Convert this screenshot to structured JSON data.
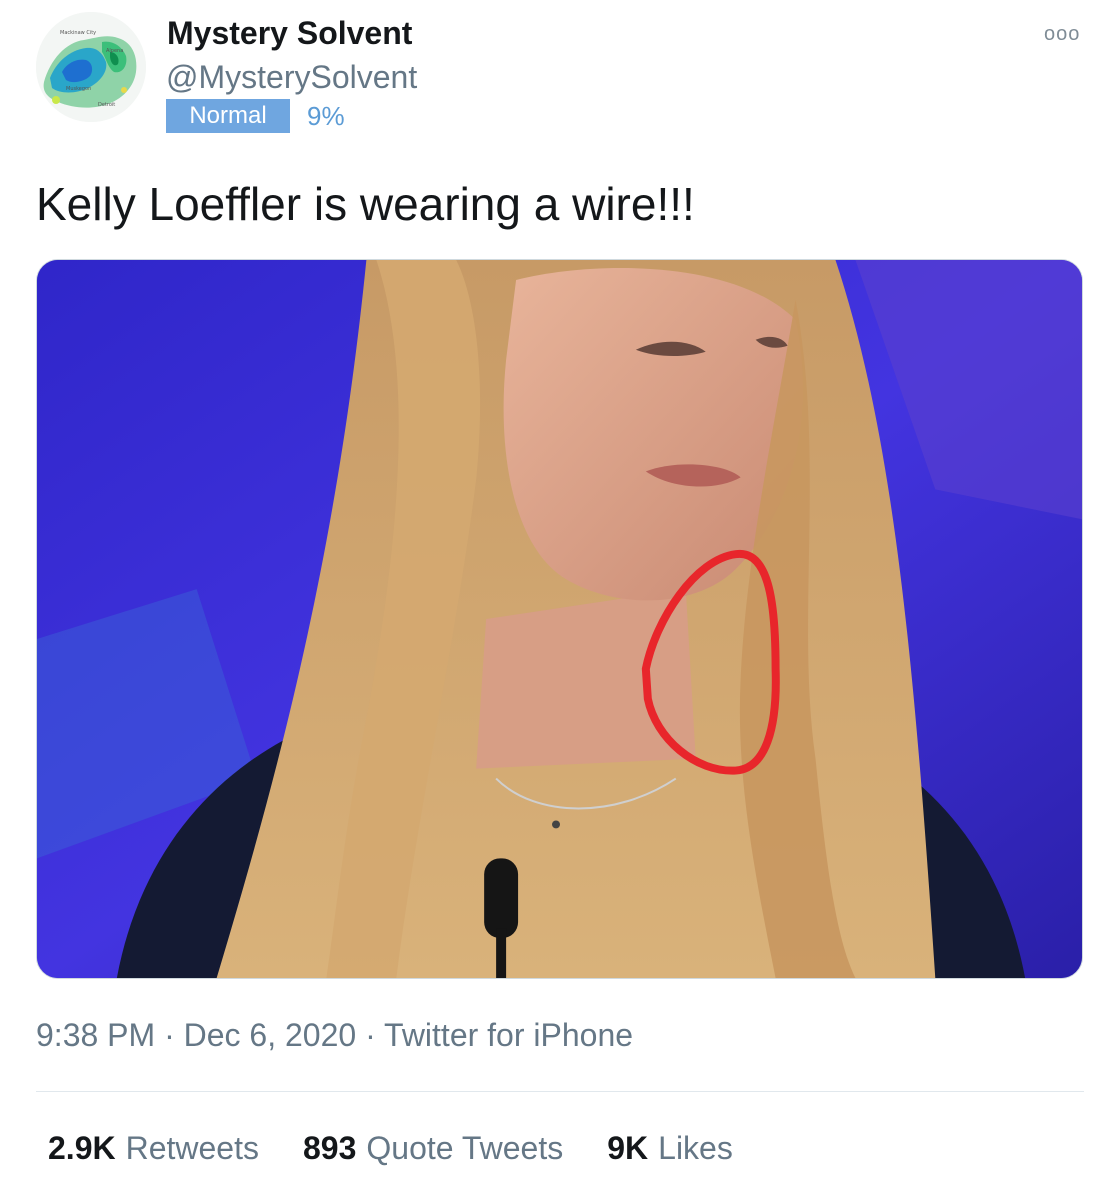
{
  "author": {
    "display_name": "Mystery Solvent",
    "handle": "@MysterySolvent",
    "badge": "Normal",
    "badge_percent": "9%"
  },
  "avatar": {
    "map_labels": [
      "Mackinaw City",
      "Alpena",
      "Muskegon",
      "Detroit"
    ]
  },
  "tweet": {
    "text": "Kelly Loeffler is wearing a wire!!!",
    "time": "9:38 PM",
    "date": "Dec 6, 2020",
    "source": "Twitter for iPhone",
    "separator": "·"
  },
  "stats": {
    "retweets": {
      "count": "2.9K",
      "label": "Retweets"
    },
    "quotes": {
      "count": "893",
      "label": "Quote Tweets"
    },
    "likes": {
      "count": "9K",
      "label": "Likes"
    }
  },
  "icons": {
    "more": "ooo"
  },
  "colors": {
    "badge_bg": "#6fa6e0",
    "percent": "#5b9bd5",
    "annotation_circle": "#e8262b",
    "stage_background": "#3b2fd0"
  }
}
